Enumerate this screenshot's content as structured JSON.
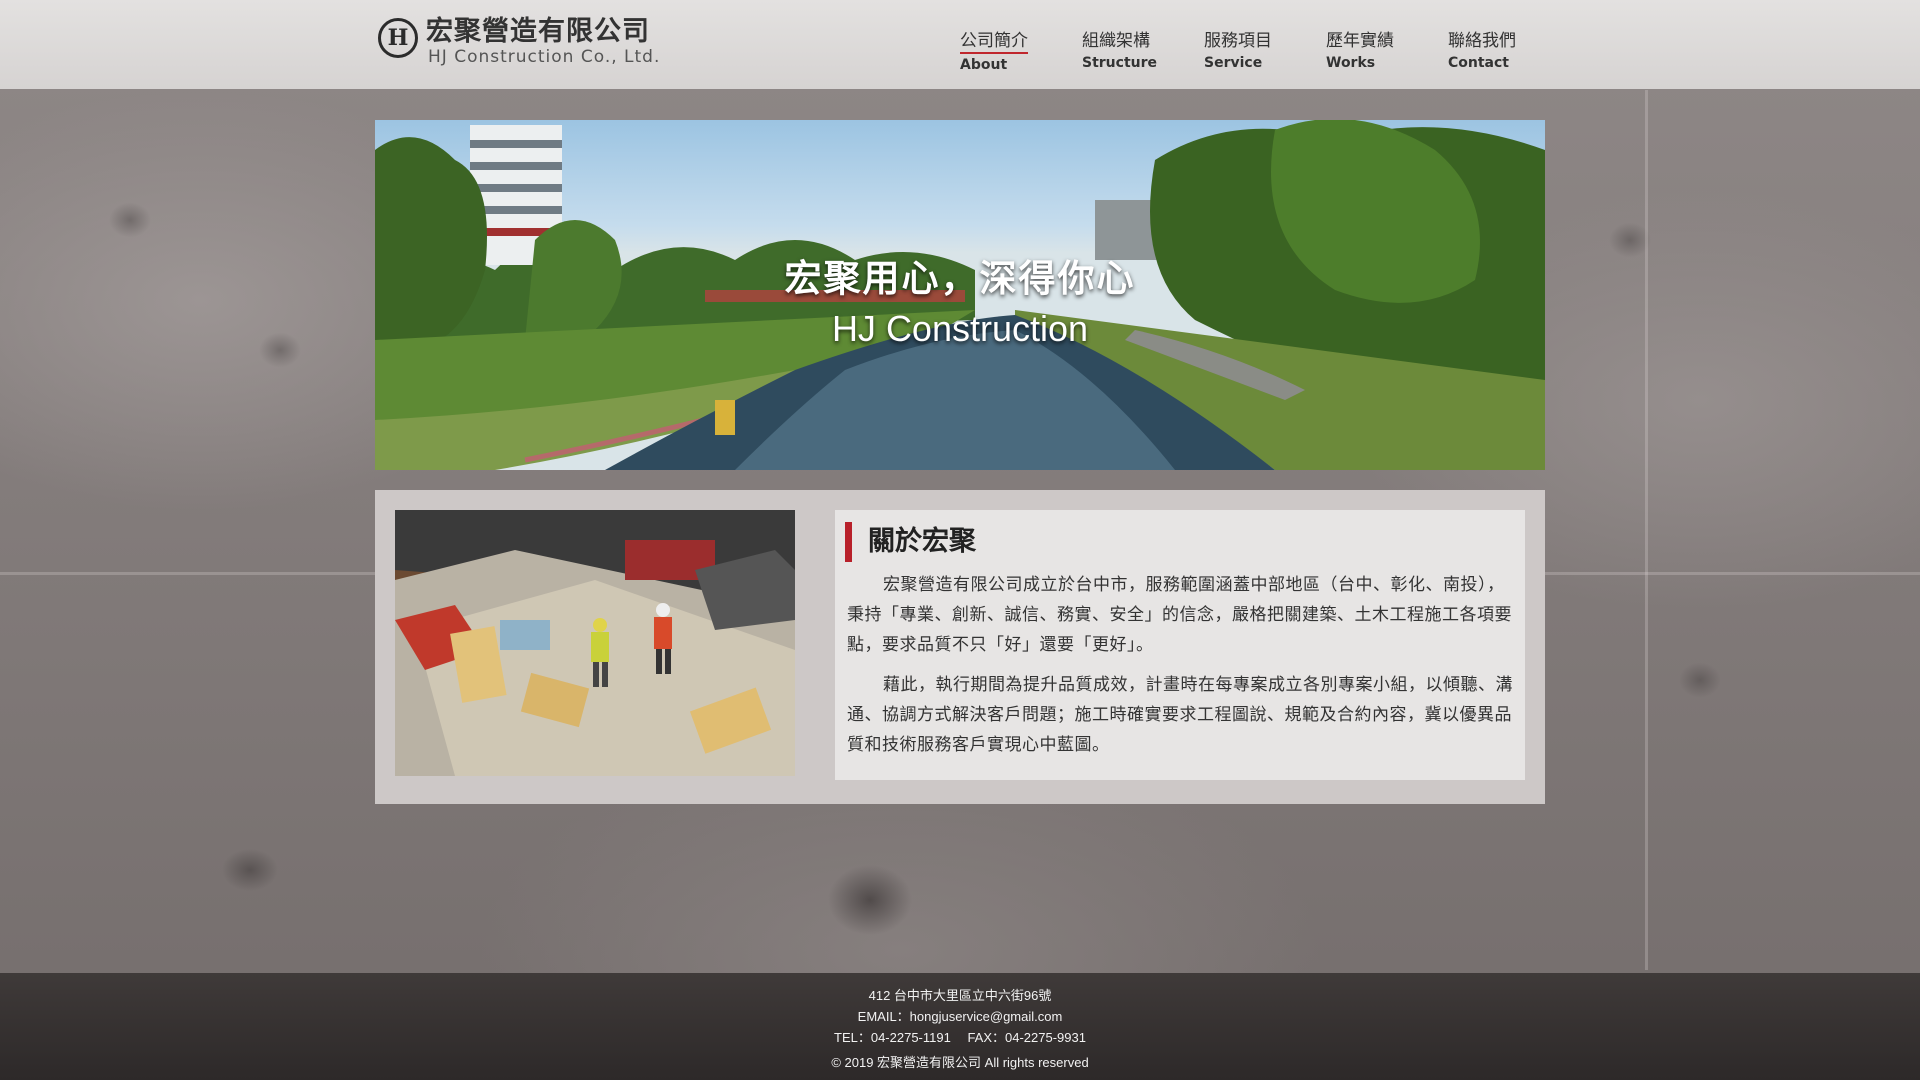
{
  "header": {
    "logo_mark": "H",
    "logo_cn": "宏聚營造有限公司",
    "logo_en": "HJ Construction Co., Ltd.",
    "nav": [
      {
        "cn": "公司簡介",
        "en": "About",
        "active": true
      },
      {
        "cn": "組織架構",
        "en": "Structure",
        "active": false
      },
      {
        "cn": "服務項目",
        "en": "Service",
        "active": false
      },
      {
        "cn": "歷年實績",
        "en": "Works",
        "active": false
      },
      {
        "cn": "聯絡我們",
        "en": "Contact",
        "active": false
      }
    ]
  },
  "banner": {
    "title_cn": "宏聚用心，深得你心",
    "title_en": "HJ Construction"
  },
  "about": {
    "title": "關於宏聚",
    "paragraphs": [
      "宏聚營造有限公司成立於台中市，服務範圍涵蓋中部地區（台中、彰化、南投），秉持「專業、創新、誠信、務實、安全」的信念，嚴格把關建築、土木工程施工各項要點，要求品質不只「好」還要「更好」。",
      "藉此，執行期間為提升品質成效，計畫時在每專案成立各別專案小組，以傾聽、溝通、協調方式解決客戶問題；施工時確實要求工程圖說、規範及合約內容，冀以優異品質和技術服務客戶實現心中藍圖。"
    ]
  },
  "footer": {
    "address": "412 台中市大里區立中六街96號",
    "email": "EMAIL：hongjuservice@gmail.com",
    "tel_fax": "TEL：04-2275-1191　 FAX：04-2275-9931",
    "copyright": "© 2019 宏聚營造有限公司 All rights reserved"
  },
  "colors": {
    "accent": "#c0272d",
    "footer_bg": "#2d2929",
    "panel_bg": "#cdc8c7"
  }
}
